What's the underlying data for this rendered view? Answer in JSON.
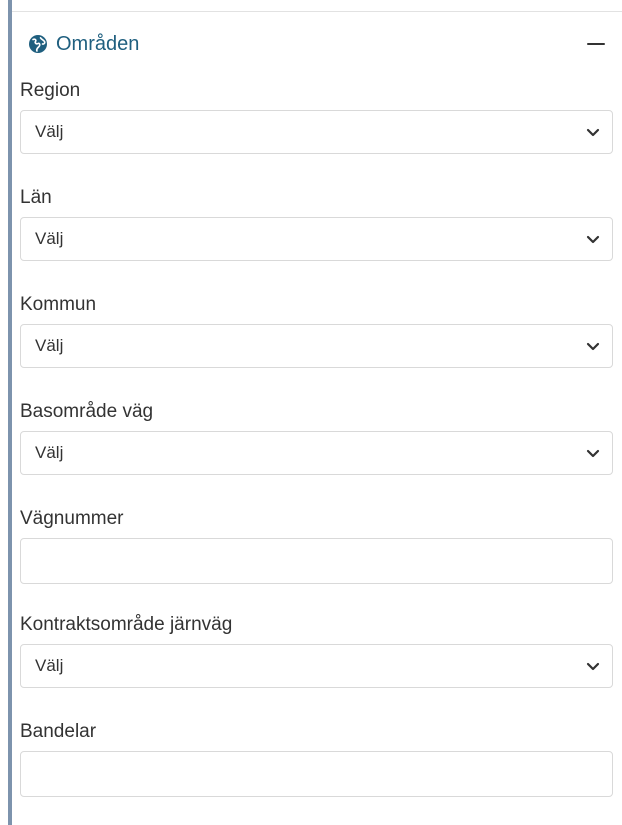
{
  "panel": {
    "title": "Områden",
    "title_icon": "globe-icon",
    "collapse_icon": "minus-icon",
    "accent_color": "#7d93ad",
    "title_color": "#1f5f7f"
  },
  "fields": {
    "region": {
      "label": "Region",
      "value": "Välj"
    },
    "lan": {
      "label": "Län",
      "value": "Välj"
    },
    "kommun": {
      "label": "Kommun",
      "value": "Välj"
    },
    "basomrade_vag": {
      "label": "Basområde väg",
      "value": "Välj"
    },
    "vagnummer": {
      "label": "Vägnummer",
      "value": ""
    },
    "kontraktsomrade_jarnvag": {
      "label": "Kontraktsområde järnväg",
      "value": "Välj"
    },
    "bandelar": {
      "label": "Bandelar",
      "value": ""
    }
  }
}
